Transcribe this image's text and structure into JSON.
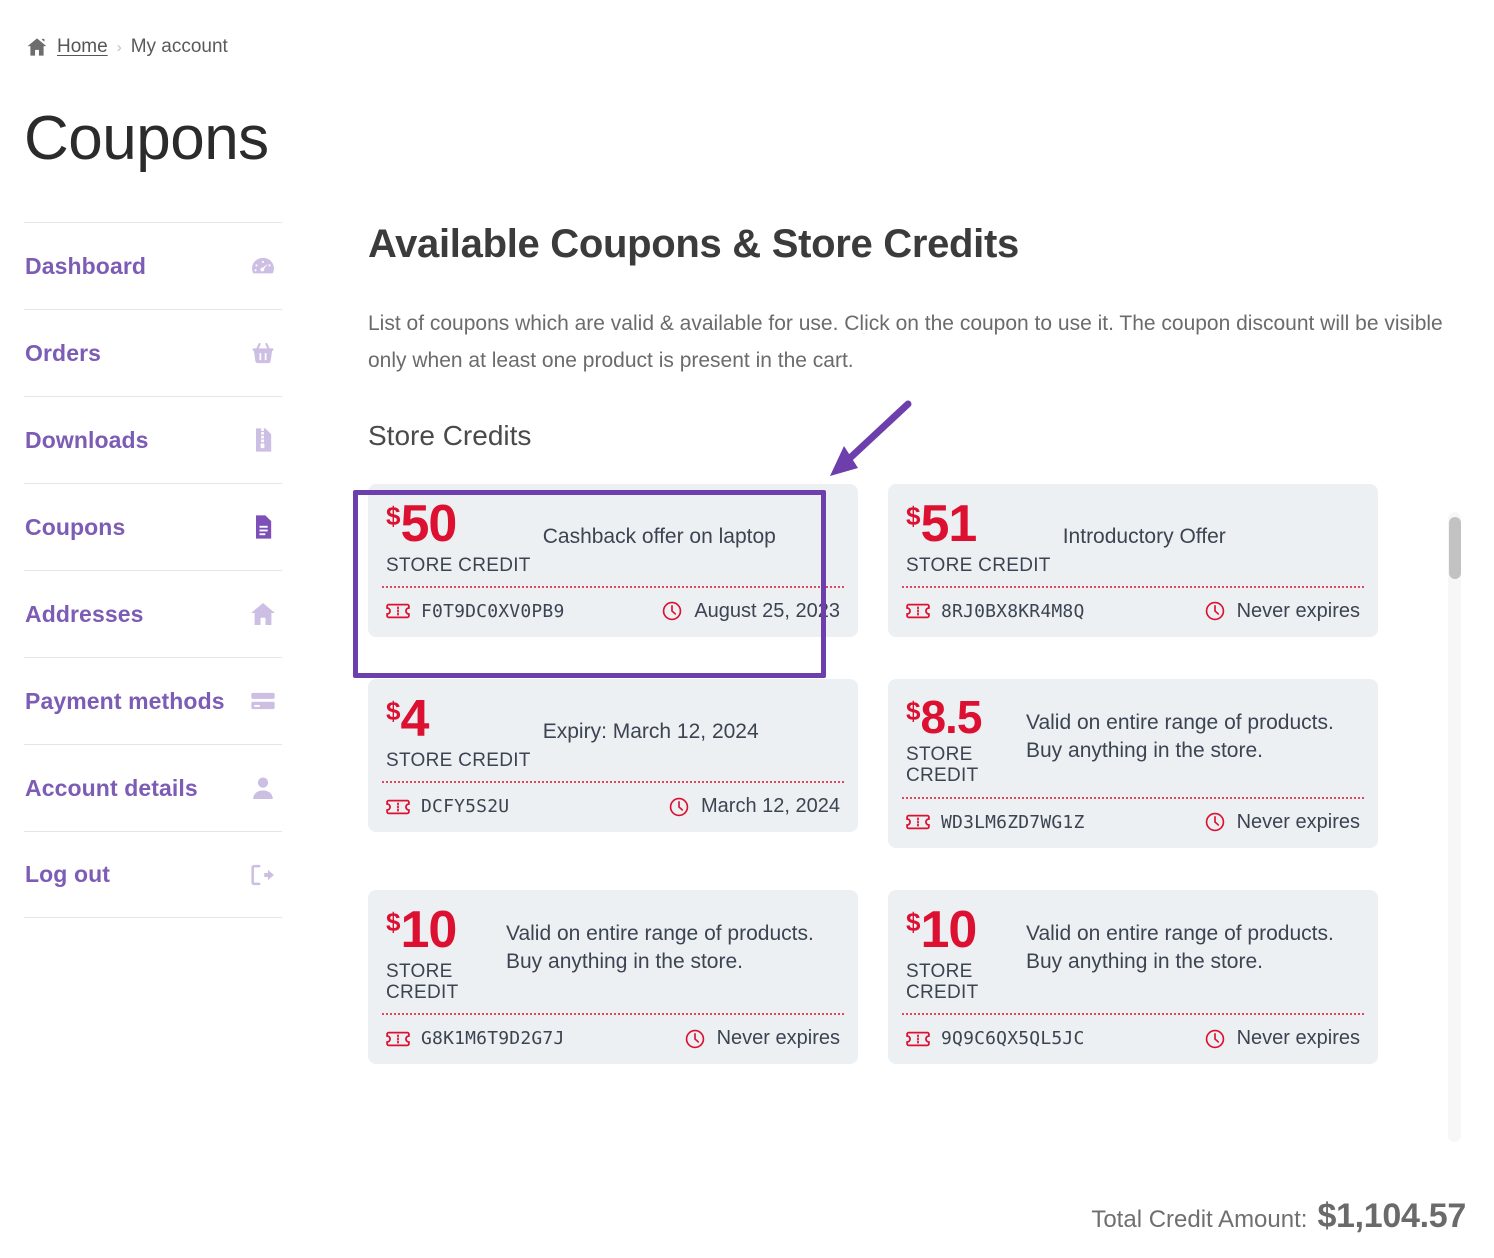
{
  "breadcrumb": {
    "home_icon": "home-icon",
    "home_label": "Home",
    "separator": "›",
    "current_label": "My account"
  },
  "page_title": "Coupons",
  "sidebar": {
    "items": [
      {
        "label": "Dashboard",
        "icon": "dashboard-gauge-icon",
        "active": false
      },
      {
        "label": "Orders",
        "icon": "basket-icon",
        "active": false
      },
      {
        "label": "Downloads",
        "icon": "zip-file-icon",
        "active": false
      },
      {
        "label": "Coupons",
        "icon": "document-lines-icon",
        "active": true
      },
      {
        "label": "Addresses",
        "icon": "house-icon",
        "active": false
      },
      {
        "label": "Payment methods",
        "icon": "credit-card-icon",
        "active": false
      },
      {
        "label": "Account details",
        "icon": "person-icon",
        "active": false
      },
      {
        "label": "Log out",
        "icon": "logout-arrow-icon",
        "active": false
      }
    ]
  },
  "main": {
    "heading": "Available Coupons & Store Credits",
    "description": "List of coupons which are valid & available for use. Click on the coupon to use it. The coupon discount will be visible only when at least one product is present in the cart.",
    "section_title": "Store Credits"
  },
  "coupons": [
    {
      "currency": "$",
      "amount": "50",
      "credit_label": "STORE CREDIT",
      "description": "Cashback offer on laptop",
      "code": "F0T9DC0XV0PB9",
      "expiry": "August 25, 2023",
      "highlighted": true
    },
    {
      "currency": "$",
      "amount": "51",
      "credit_label": "STORE CREDIT",
      "description": "Introductory Offer",
      "code": "8RJ0BX8KR4M8Q",
      "expiry": "Never expires",
      "highlighted": false
    },
    {
      "currency": "$",
      "amount": "4",
      "credit_label": "STORE CREDIT",
      "description": "Expiry: March 12, 2024",
      "code": "DCFY5S2U",
      "expiry": "March 12, 2024",
      "highlighted": false
    },
    {
      "currency": "$",
      "amount": "8.5",
      "credit_label": "STORE\nCREDIT",
      "description": "Valid on entire range of products. Buy anything in the store.",
      "code": "WD3LM6ZD7WG1Z",
      "expiry": "Never expires",
      "highlighted": false
    },
    {
      "currency": "$",
      "amount": "10",
      "credit_label": "STORE\nCREDIT",
      "description": "Valid on entire range of products. Buy anything in the store.",
      "code": "G8K1M6T9D2G7J",
      "expiry": "Never expires",
      "highlighted": false
    },
    {
      "currency": "$",
      "amount": "10",
      "credit_label": "STORE\nCREDIT",
      "description": "Valid on entire range of products. Buy anything in the store.",
      "code": "9Q9C6QX5QL5JC",
      "expiry": "Never expires",
      "highlighted": false
    }
  ],
  "footer": {
    "total_label": "Total Credit Amount:",
    "total_value": "$1,104.57"
  },
  "annotation": {
    "highlight_color": "#6c3fad",
    "arrow_color": "#6c3fad",
    "target": "coupon-card-0"
  },
  "colors": {
    "accent_purple": "#7c5cb5",
    "accent_red": "#dc1030",
    "card_bg": "#edf0f3",
    "text_dark": "#3c4452"
  },
  "icons": {
    "coupon_ticket": "ticket-icon",
    "clock": "clock-icon"
  }
}
